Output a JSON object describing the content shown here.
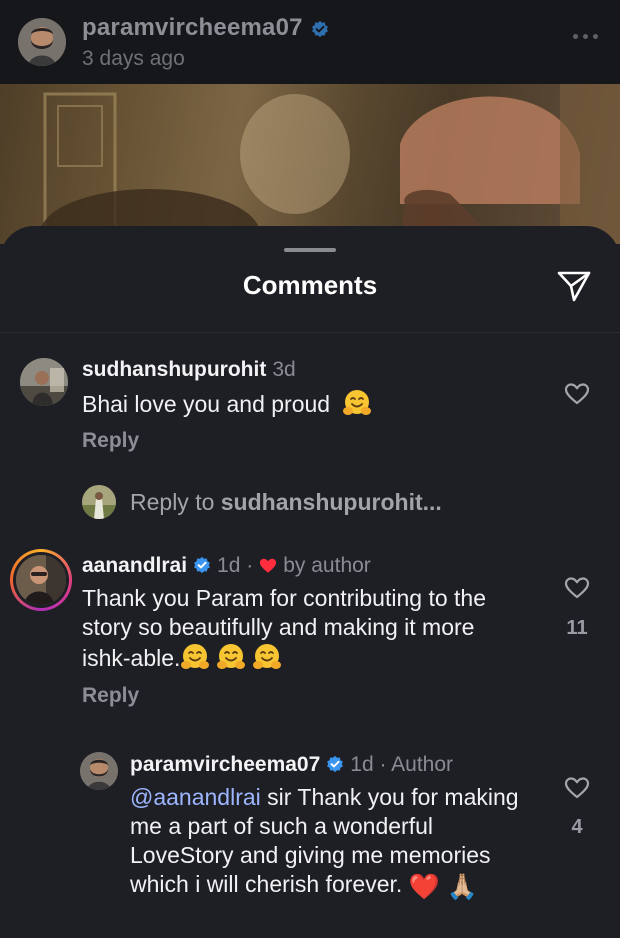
{
  "post": {
    "username": "paramvircheema07",
    "time": "3 days ago"
  },
  "sheet": {
    "title": "Comments"
  },
  "comments": [
    {
      "username": "sudhanshupurohit",
      "meta": "3d",
      "text": "Bhai love you and proud",
      "reply_label": "Reply",
      "view_replies_prefix": "Reply to ",
      "view_replies_user": "sudhanshupurohit..."
    },
    {
      "username": "aanandlrai",
      "meta": "1d ·",
      "liked_by": "by author",
      "text": "Thank you Param for contributing to the story so beautifully and making it more ishk-able.",
      "like_count": "11",
      "reply_label": "Reply"
    },
    {
      "username": "paramvircheema07",
      "meta": "1d · Author",
      "mention": "@aanandlrai",
      "text": " sir Thank you for making me a part of such a wonderful LoveStory and giving me memories which i will cherish forever.",
      "emoji": "❤️ 🙏🏼",
      "like_count": "4"
    }
  ],
  "colors": {
    "background": "#1e1f24",
    "verified": "#3a95f0",
    "mention": "#9db6ff",
    "heart": "#ff2d3d"
  }
}
